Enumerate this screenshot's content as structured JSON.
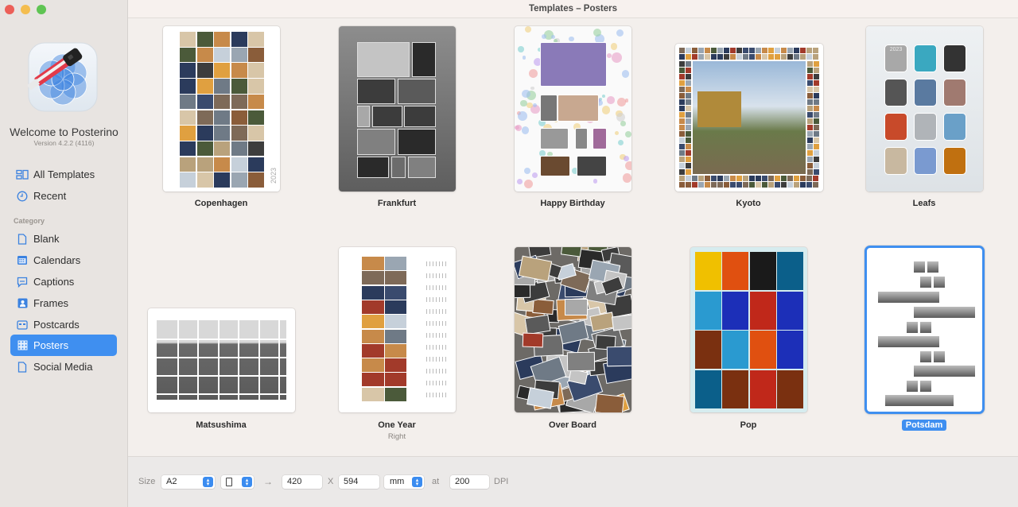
{
  "window": {
    "title": "Templates – Posters"
  },
  "sidebar": {
    "app_name": "Welcome to Posterino",
    "version": "Version 4.2.2 (4116)",
    "top_items": [
      {
        "label": "All Templates",
        "icon": "all-templates-icon"
      },
      {
        "label": "Recent",
        "icon": "clock-icon"
      }
    ],
    "category_label": "Category",
    "categories": [
      {
        "label": "Blank",
        "icon": "document-icon",
        "active": false
      },
      {
        "label": "Calendars",
        "icon": "calendar-icon",
        "active": false
      },
      {
        "label": "Captions",
        "icon": "caption-bubble-icon",
        "active": false
      },
      {
        "label": "Frames",
        "icon": "portrait-frame-icon",
        "active": false
      },
      {
        "label": "Postcards",
        "icon": "postcard-icon",
        "active": false
      },
      {
        "label": "Posters",
        "icon": "grid-icon",
        "active": true
      },
      {
        "label": "Social Media",
        "icon": "document-icon",
        "active": false
      }
    ]
  },
  "templates": [
    {
      "name": "Copenhagen",
      "subtitle": "",
      "selected": false,
      "year_label": "2023"
    },
    {
      "name": "Frankfurt",
      "subtitle": "",
      "selected": false
    },
    {
      "name": "Happy Birthday",
      "subtitle": "",
      "selected": false
    },
    {
      "name": "Kyoto",
      "subtitle": "",
      "selected": false
    },
    {
      "name": "Leafs",
      "subtitle": "",
      "selected": false,
      "year_label": "2023"
    },
    {
      "name": "Matsushima",
      "subtitle": "",
      "selected": false
    },
    {
      "name": "One Year",
      "subtitle": "Right",
      "selected": false
    },
    {
      "name": "Over Board",
      "subtitle": "",
      "selected": false
    },
    {
      "name": "Pop",
      "subtitle": "",
      "selected": false
    },
    {
      "name": "Potsdam",
      "subtitle": "",
      "selected": true
    }
  ],
  "bottom_bar": {
    "size_label": "Size",
    "size_value": "A2",
    "orientation": "portrait",
    "arrow": "→",
    "width_value": "420",
    "x_label": "X",
    "height_value": "594",
    "unit_value": "mm",
    "at_label": "at",
    "dpi_value": "200",
    "dpi_label": "DPI"
  },
  "colors": {
    "accent": "#3f8ff0",
    "sidebar_bg": "#e8e4e1",
    "content_bg": "#f3efec"
  }
}
